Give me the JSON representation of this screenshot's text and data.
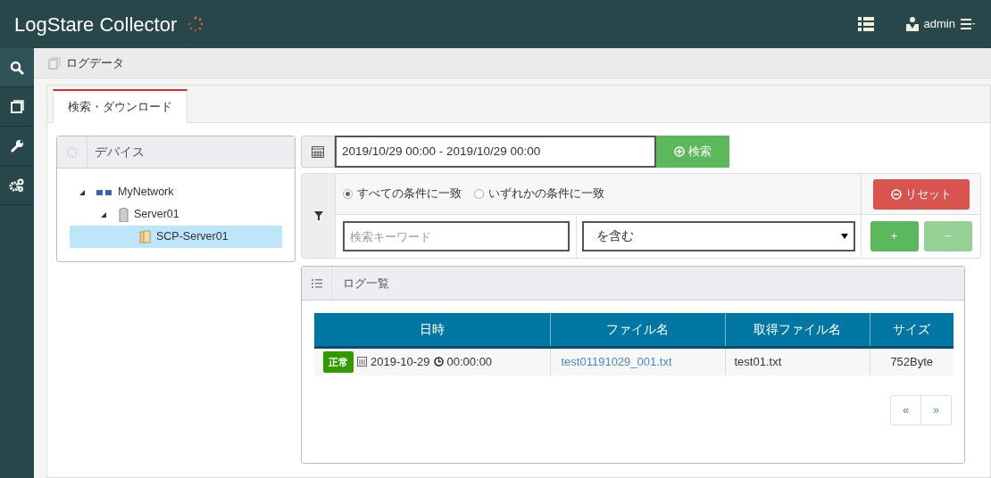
{
  "header": {
    "title": "LogStare Collector",
    "user": "admin"
  },
  "breadcrumb": "ログデータ",
  "tabs": [
    {
      "label": "検索・ダウンロード",
      "selected": true
    }
  ],
  "device_panel": {
    "title": "デバイス",
    "tree": [
      {
        "label": "MyNetwork",
        "kind": "network",
        "expanded": true,
        "selected": false,
        "children": [
          {
            "label": "Server01",
            "kind": "server",
            "expanded": true,
            "selected": false,
            "children": [
              {
                "label": "SCP-Server01",
                "kind": "folder",
                "selected": true
              }
            ]
          }
        ]
      }
    ]
  },
  "date_range": {
    "value": "2019/10/29 00:00 - 2019/10/29 00:00"
  },
  "search_button": "検索",
  "filter": {
    "match_options": [
      {
        "label": "すべての条件に一致",
        "selected": true
      },
      {
        "label": "いずれかの条件に一致",
        "selected": false
      }
    ],
    "reset_button": "リセット",
    "keyword": {
      "placeholder": "検索キーワード"
    },
    "operator": "を含む",
    "add_button": {
      "label": "+",
      "disabled": false
    },
    "remove_button": {
      "label": "−",
      "disabled": true
    }
  },
  "log_list": {
    "title": "ログ一覧",
    "columns": [
      "日時",
      "ファイル名",
      "取得ファイル名",
      "サイズ"
    ],
    "rows": [
      {
        "status": "正常",
        "date": "2019-10-29",
        "time": "00:00:00",
        "file_name": "test01191029_001.txt",
        "acquired_file_name": "test01.txt",
        "size": "752Byte"
      }
    ],
    "pagination": [
      "«",
      "»"
    ]
  }
}
